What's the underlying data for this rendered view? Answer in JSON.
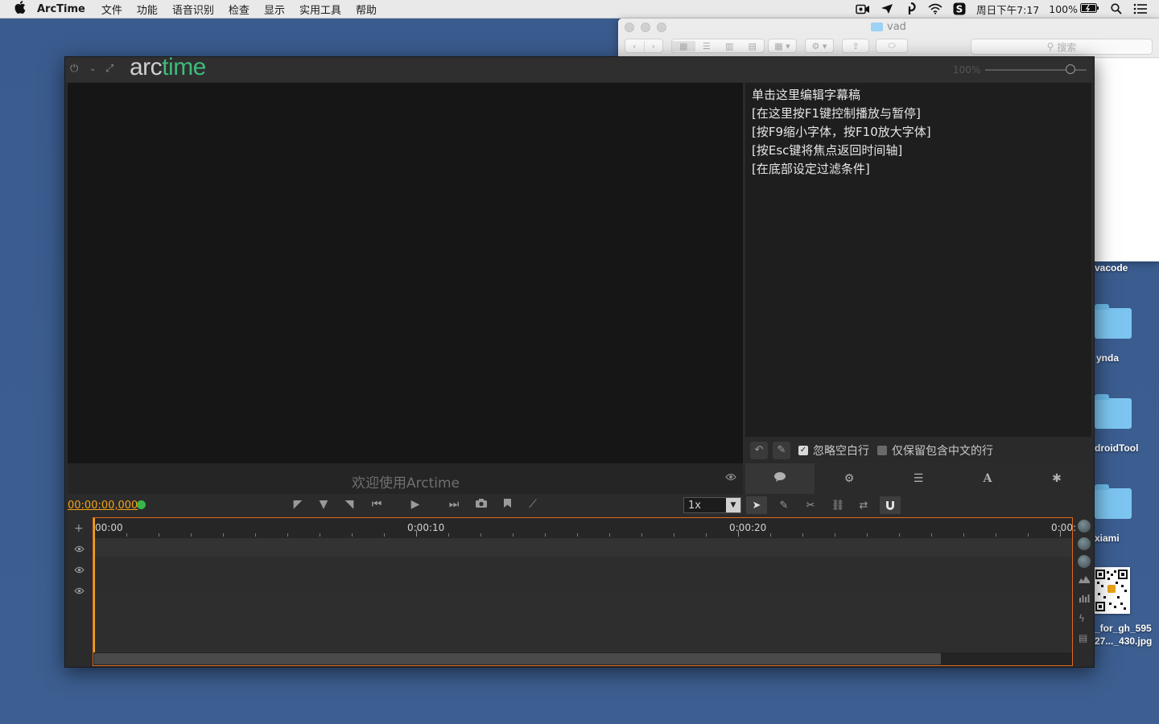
{
  "menubar": {
    "app_name": "ArcTime",
    "items": [
      "文件",
      "功能",
      "语音识别",
      "检查",
      "显示",
      "实用工具",
      "帮助"
    ],
    "clock": "周日下午7:17",
    "battery": "100%"
  },
  "finder": {
    "title": "vad",
    "search_placeholder": "搜索"
  },
  "desktop": {
    "items": [
      {
        "label": "vacode"
      },
      {
        "label": "ynda"
      },
      {
        "label": "droidTool"
      },
      {
        "label": "xiami"
      },
      {
        "label_line1": "_for_gh_595",
        "label_line2": "27..._430.jpg"
      }
    ]
  },
  "arctime": {
    "logo_part1": "arc",
    "logo_part2": "time",
    "logo_color": "#3dbb7d",
    "zoom": "100%",
    "welcome": "欢迎使用Arctime",
    "script_lines": [
      "单击这里编辑字幕稿",
      "[在这里按F1键控制播放与暂停]",
      "[按F9缩小字体，按F10放大字体]",
      "[按Esc键将焦点返回时间轴]",
      "[在底部设定过滤条件]"
    ],
    "options": {
      "ignore_blank": "忽略空白行",
      "keep_chinese_only": "仅保留包含中文的行"
    },
    "timecode": "00:00:00,000",
    "timecode_color": "#f0a31a",
    "speed": "1x",
    "ruler_labels": [
      "00:00",
      "0:00:10",
      "0:00:20",
      "0:00:"
    ],
    "accent_border": "#e06a1f"
  }
}
